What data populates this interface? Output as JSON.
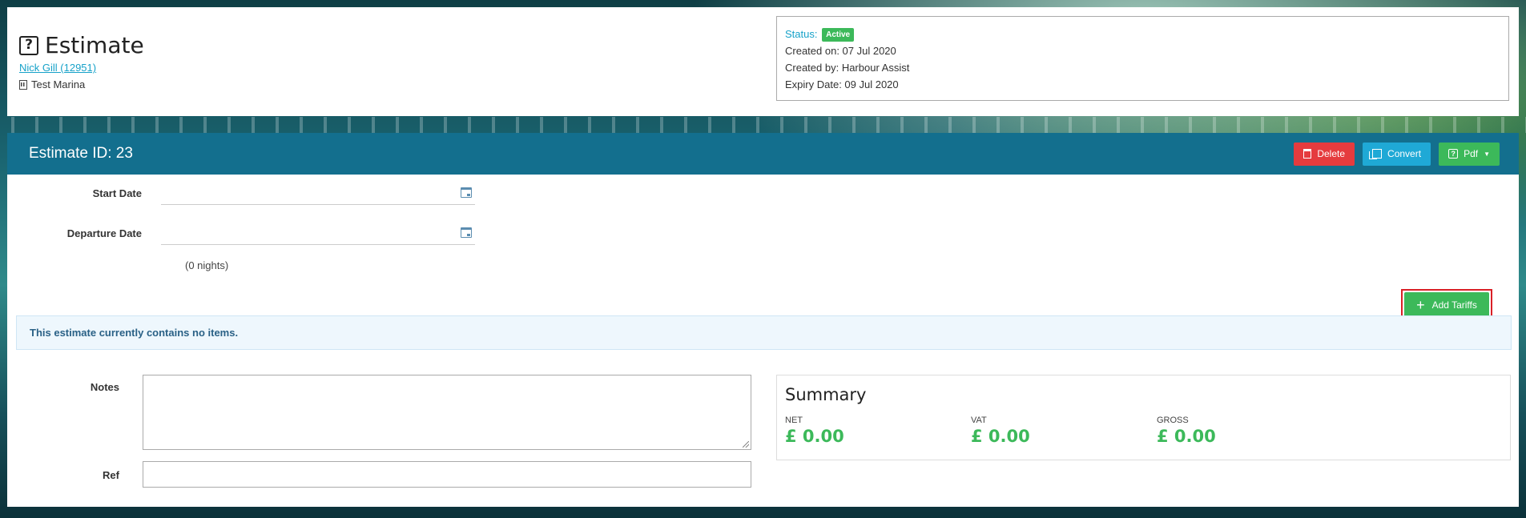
{
  "header": {
    "title": "Estimate",
    "customer_link": "Nick Gill (12951)",
    "marina": "Test Marina"
  },
  "status_box": {
    "status_label": "Status:",
    "status_badge": "Active",
    "created_on": "Created on: 07 Jul 2020",
    "created_by": "Created by: Harbour Assist",
    "expiry_date": "Expiry Date: 09 Jul 2020"
  },
  "main": {
    "estimate_id": "Estimate ID: 23",
    "actions": {
      "delete_label": "Delete",
      "convert_label": "Convert",
      "pdf_label": "Pdf"
    },
    "start_date_label": "Start Date",
    "start_date_value": "",
    "departure_date_label": "Departure Date",
    "departure_date_value": "",
    "nights": "(0 nights)",
    "add_tariffs_label": "Add Tariffs",
    "empty_message": "This estimate currently contains no items.",
    "notes_label": "Notes",
    "notes_value": "",
    "ref_label": "Ref",
    "ref_value": ""
  },
  "summary": {
    "title": "Summary",
    "columns": [
      {
        "label": "NET",
        "value": "£ 0.00"
      },
      {
        "label": "VAT",
        "value": "£ 0.00"
      },
      {
        "label": "GROSS",
        "value": "£ 0.00"
      }
    ]
  },
  "colors": {
    "header_bar": "#136f8e",
    "delete": "#e53b3e",
    "convert": "#1fa9d6",
    "success": "#3cb95a",
    "link": "#17a2c9",
    "highlight_border": "#d92027"
  }
}
